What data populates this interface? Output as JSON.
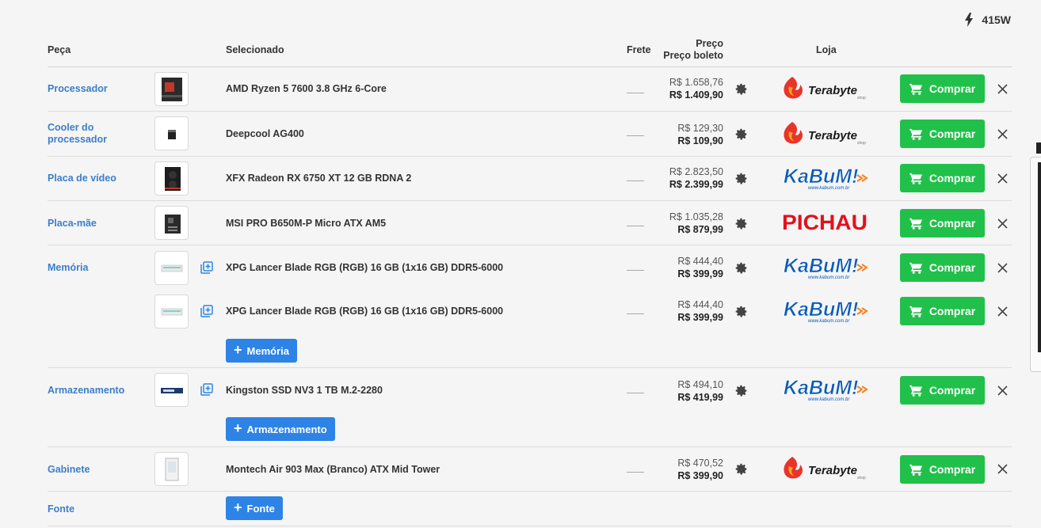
{
  "power": {
    "icon": "lightning-bolt-icon",
    "wattage": "415W"
  },
  "header": {
    "peca": "Peça",
    "selecionado": "Selecionado",
    "frete": "Frete",
    "preco": "Preço",
    "preco_boleto": "Preço boleto",
    "loja": "Loja"
  },
  "actions": {
    "buy_label": "Comprar"
  },
  "rows": [
    {
      "category": "Processador",
      "name": "AMD Ryzen 5 7600 3.8 GHz 6-Core",
      "price": "R$ 1.658,76",
      "price_boleto": "R$ 1.409,90",
      "store": "Terabyte"
    },
    {
      "category": "Cooler do processador",
      "name": "Deepcool AG400",
      "price": "R$ 129,30",
      "price_boleto": "R$ 109,90",
      "store": "Terabyte"
    },
    {
      "category": "Placa de vídeo",
      "name": "XFX Radeon RX 6750 XT 12 GB RDNA 2",
      "price": "R$ 2.823,50",
      "price_boleto": "R$ 2.399,99",
      "store": "KaBuM!"
    },
    {
      "category": "Placa-mãe",
      "name": "MSI PRO B650M-P Micro ATX AM5",
      "price": "R$ 1.035,28",
      "price_boleto": "R$ 879,99",
      "store": "PICHAU"
    },
    {
      "category": "Memória",
      "name": "XPG Lancer Blade RGB (RGB) 16 GB (1x16 GB) DDR5-6000",
      "price": "R$ 444,40",
      "price_boleto": "R$ 399,99",
      "store": "KaBuM!"
    },
    {
      "category": "",
      "name": "XPG Lancer Blade RGB (RGB) 16 GB (1x16 GB) DDR5-6000",
      "price": "R$ 444,40",
      "price_boleto": "R$ 399,99",
      "store": "KaBuM!"
    },
    {
      "category": "Armazenamento",
      "name": "Kingston SSD NV3 1 TB M.2-2280",
      "price": "R$ 494,10",
      "price_boleto": "R$ 419,99",
      "store": "KaBuM!"
    },
    {
      "category": "Gabinete",
      "name": "Montech Air 903 Max (Branco) ATX Mid Tower",
      "price": "R$ 470,52",
      "price_boleto": "R$ 399,90",
      "store": "Terabyte"
    }
  ],
  "add_buttons": {
    "memoria": "Memória",
    "armazenamento": "Armazenamento",
    "fonte": "Fonte"
  },
  "fonte_category": "Fonte",
  "store_logos": {
    "terabyte": {
      "text": "Terabyte",
      "sub": "shop",
      "color": "#1a1a1a",
      "flame": "#e8342a"
    },
    "kabum": {
      "text": "KaBuM!",
      "sub": "www.kabum.com.br",
      "color": "#0a5bb8",
      "accent": "#f5821f"
    },
    "pichau": {
      "text": "PICHAU",
      "color": "#e3111b"
    }
  },
  "colors": {
    "link": "#3d7ec9",
    "buy": "#21c04a",
    "add": "#2d83e6"
  }
}
